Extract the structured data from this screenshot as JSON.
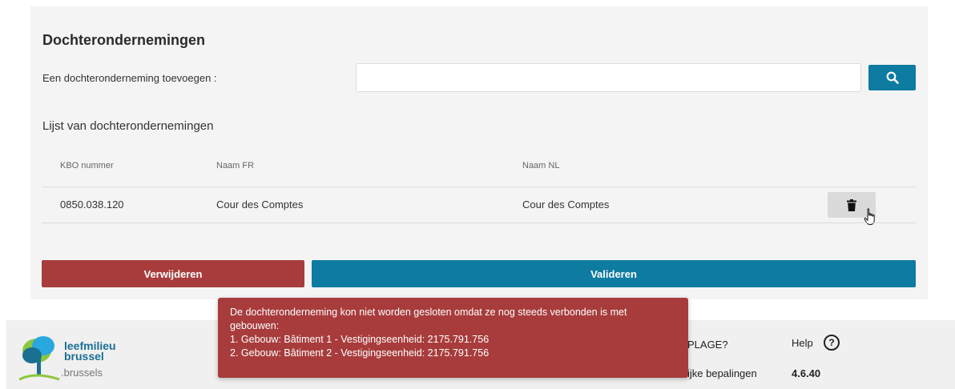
{
  "section": {
    "title": "Dochterondernemingen",
    "add_label": "Een dochteronderneming toevoegen :",
    "search_value": "",
    "list_heading": "Lijst van dochterondernemingen"
  },
  "table": {
    "headers": [
      "KBO nummer",
      "Naam FR",
      "Naam NL"
    ],
    "rows": [
      {
        "kbo": "0850.038.120",
        "naam_fr": "Cour des Comptes",
        "naam_nl": "Cour des Comptes"
      }
    ]
  },
  "actions": {
    "remove_label": "Verwijderen",
    "validate_label": "Valideren"
  },
  "footer": {
    "logo_line1": "leefmilieu",
    "logo_line2": "brussel",
    "logo_domain": ".brussels",
    "link_plage": "PLAGE?",
    "link_bepalingen": "ijke bepalingen",
    "help_label": "Help",
    "version": "4.6.40"
  },
  "toast": {
    "line1": "De dochteronderneming kon niet worden gesloten omdat ze nog steeds verbonden is met",
    "line2": "gebouwen:",
    "line3": "1. Gebouw: Bâtiment 1 - Vestigingseenheid: 2175.791.756",
    "line4": "2. Gebouw: Bâtiment 2 - Vestigingseenheid: 2175.791.756"
  },
  "colors": {
    "primary": "#0e7ba1",
    "danger": "#a83c3c",
    "panel_bg": "#f4f4f4"
  },
  "icons": {
    "search": "search-icon",
    "trash": "trash-icon",
    "cursor": "hand-cursor-icon",
    "help": "help-circle-icon"
  }
}
